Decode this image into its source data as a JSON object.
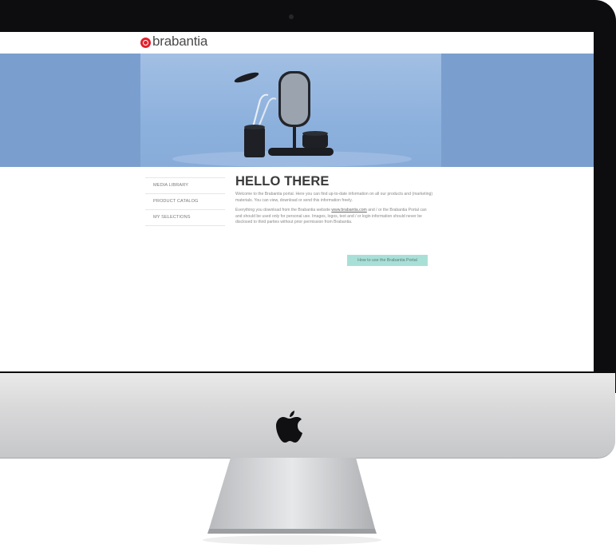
{
  "brand": {
    "logo_text": "brabantia",
    "accent_color": "#e2202c"
  },
  "banner": {
    "image_color": "#8db1dd"
  },
  "nav": {
    "items": [
      {
        "label": "MEDIA LIBRARY"
      },
      {
        "label": "PRODUCT CATALOG"
      },
      {
        "label": "MY SELECTIONS"
      }
    ]
  },
  "main": {
    "title": "HELLO THERE",
    "intro": "Welcome to the Brabantia portal. Here you can find up-to-date information on all our products and (marketing) materials. You can view, download or send this information freely.",
    "notice_before_link": "Everything you download from the Brabantia website ",
    "notice_link": "www.brabantia.com",
    "notice_after_link": " and / or the Brabantia Portal can and should be used only for personal use. Images, logos, text and / or login information should never be disclosed to third parties without prior permission from Brabantia.",
    "help_button": "How to use the Brabantia Portal",
    "help_button_color": "#a8e0d8"
  },
  "device": {
    "logo_icon": "apple-logo-icon"
  }
}
